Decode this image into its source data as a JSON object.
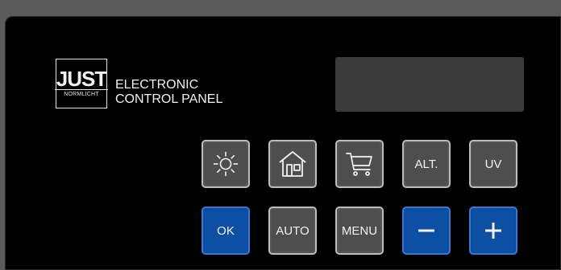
{
  "logo": {
    "word": "JUST",
    "sub": "NORMLICHT"
  },
  "panel_title": {
    "line1": "ELECTRONIC",
    "line2": "CONTROL PANEL"
  },
  "buttons_top": [
    {
      "name": "daylight-button",
      "icon": "sun-icon"
    },
    {
      "name": "home-button",
      "icon": "house-icon"
    },
    {
      "name": "shop-button",
      "icon": "cart-icon"
    },
    {
      "name": "alt-button",
      "label": "ALT."
    },
    {
      "name": "uv-button",
      "label": "UV"
    }
  ],
  "buttons_bottom": [
    {
      "name": "ok-button",
      "label": "OK"
    },
    {
      "name": "auto-button",
      "label": "AUTO"
    },
    {
      "name": "menu-button",
      "label": "MENU"
    },
    {
      "name": "minus-button",
      "icon": "minus-icon"
    },
    {
      "name": "plus-button",
      "icon": "plus-icon"
    }
  ],
  "colors": {
    "panel": "#000000",
    "frame": "#5b5b5b",
    "accent_blue": "#0d4fa3",
    "key_gray": "#4e4e4e"
  }
}
